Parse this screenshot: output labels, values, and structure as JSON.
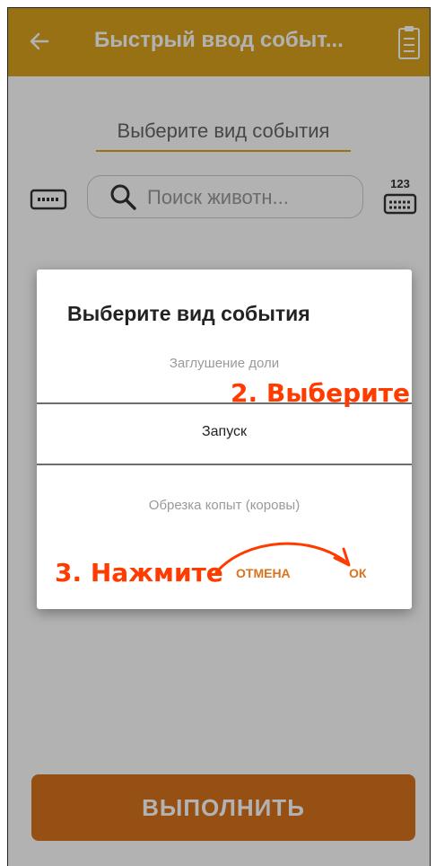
{
  "app_bar": {
    "title": "Быстрый ввод событ...",
    "back_icon": "arrow-left-icon",
    "action_icon": "clipboard-icon",
    "color": "#d9a31c"
  },
  "form": {
    "event_type_label": "Выберите вид события",
    "search_placeholder": "Поиск животн...",
    "keyboard_icon": "keyboard-icon",
    "numpad_icon": "numeric-keyboard-icon",
    "numpad_label": "123",
    "execute_label": "ВЫПОЛНИТЬ"
  },
  "dialog": {
    "title": "Выберите вид события",
    "items": [
      "Заглушение доли",
      "Запуск",
      "Обрезка копыт (коровы)"
    ],
    "selected_index": 1,
    "cancel_label": "ОТМЕНА",
    "ok_label": "ОК",
    "accent": "#d9731c"
  },
  "annotations": {
    "step2": "2. Выберите",
    "step3": "3. Нажмите",
    "color": "#ff3b00"
  }
}
